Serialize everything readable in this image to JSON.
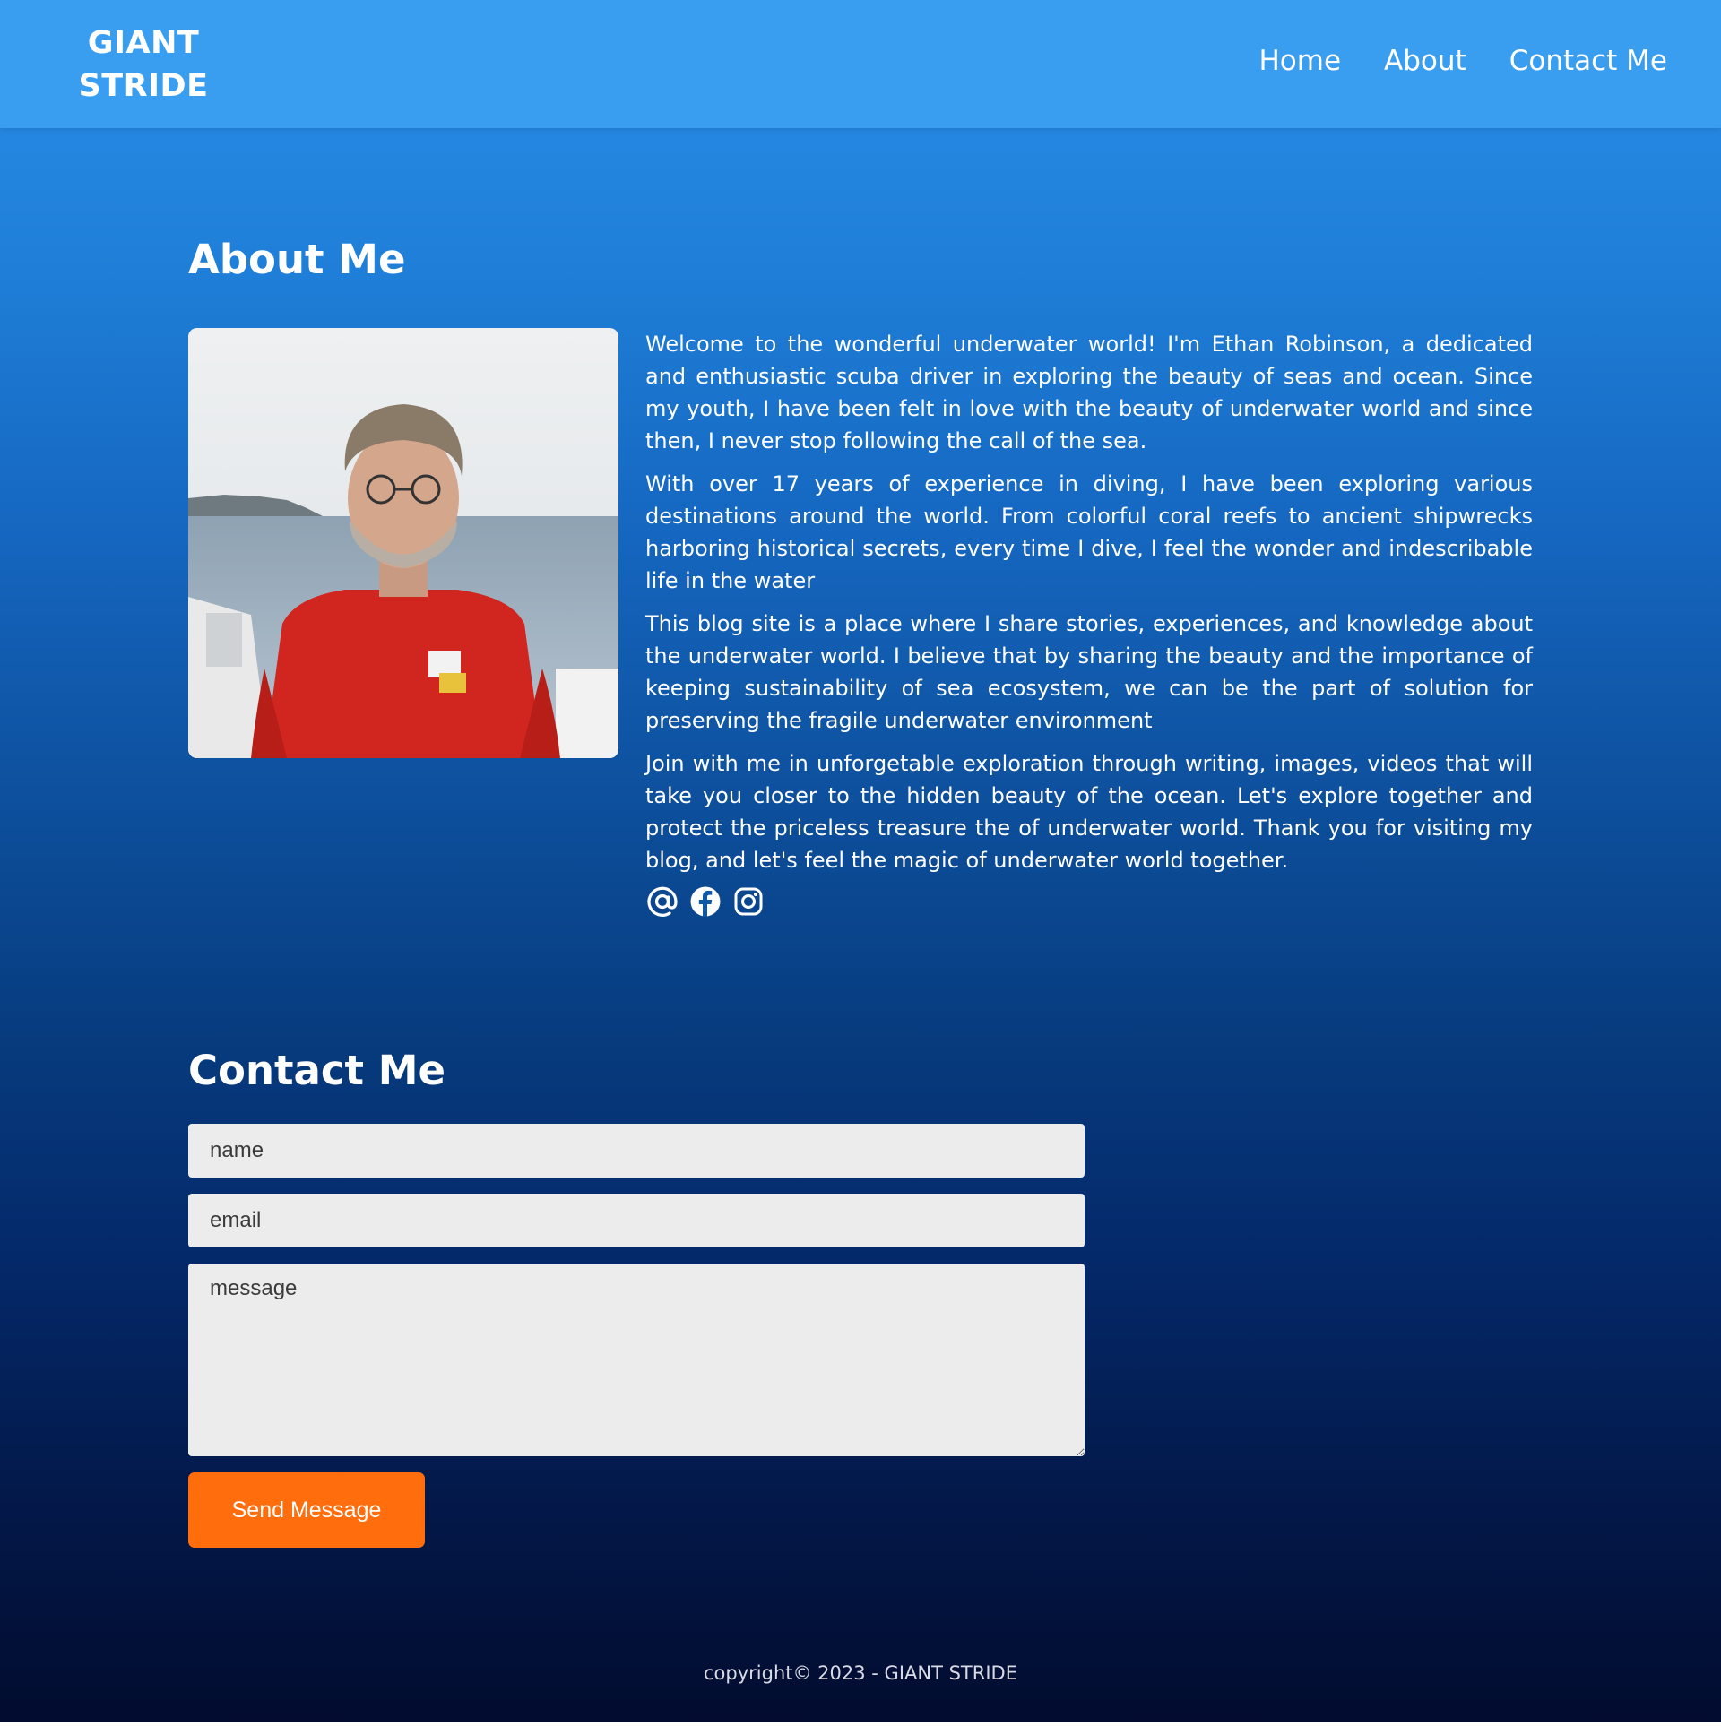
{
  "header": {
    "brand_line1": "GIANT",
    "brand_line2": "STRIDE",
    "nav": [
      {
        "label": "Home"
      },
      {
        "label": "About"
      },
      {
        "label": "Contact Me"
      }
    ]
  },
  "about": {
    "title": "About Me",
    "photo_icon": "portrait-photo",
    "paragraphs": [
      "Welcome to the wonderful underwater world! I'm Ethan Robinson, a dedicated and enthusiastic scuba driver in exploring the beauty of seas and ocean. Since my youth, I have been felt in love with the beauty of underwater world and since then, I never stop following the call of the sea.",
      "With over 17 years of experience in diving, I have been exploring various destinations around the world. From colorful coral reefs to ancient shipwrecks harboring historical secrets, every time I dive, I feel the wonder and indescribable life in the water",
      "This blog site is a place where I share stories, experiences, and knowledge about the underwater world. I believe that by sharing the beauty and the importance of keeping sustainability of sea ecosystem, we can be the part of solution for preserving the fragile underwater environment",
      "Join with me in unforgetable exploration through writing, images, videos that will take you closer to the hidden beauty of the ocean. Let's explore together and protect the priceless treasure the of underwater world. Thank you for visiting my blog, and let's feel the magic of underwater world together."
    ],
    "social_icons": [
      "at-sign-icon",
      "facebook-icon",
      "instagram-icon"
    ]
  },
  "contact": {
    "title": "Contact Me",
    "name_placeholder": "name",
    "email_placeholder": "email",
    "message_placeholder": "message",
    "send_label": "Send Message"
  },
  "footer": {
    "copyright": "copyright© 2023 - GIANT STRIDE"
  },
  "colors": {
    "navbar": "#3a9ef0",
    "button": "#ff6d0c",
    "field": "#ececec"
  }
}
